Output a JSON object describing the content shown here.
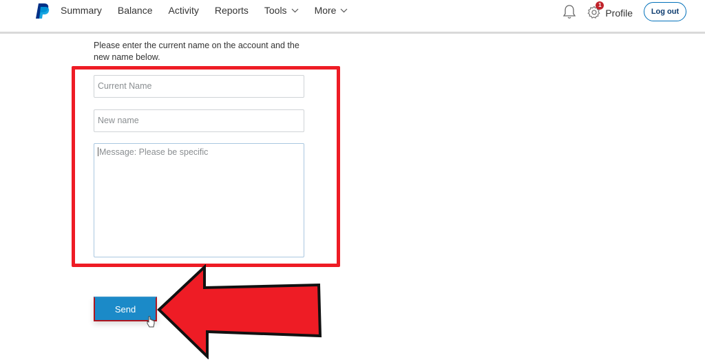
{
  "header": {
    "logo": "paypal-logo",
    "nav": [
      {
        "label": "Summary",
        "has_dropdown": false
      },
      {
        "label": "Balance",
        "has_dropdown": false
      },
      {
        "label": "Activity",
        "has_dropdown": false
      },
      {
        "label": "Reports",
        "has_dropdown": false
      },
      {
        "label": "Tools",
        "has_dropdown": true
      },
      {
        "label": "More",
        "has_dropdown": true
      }
    ],
    "notification_badge": "1",
    "profile_label": "Profile",
    "logout_label": "Log out"
  },
  "form": {
    "instructions": "Please enter the current name on the account and the new name below.",
    "current_name": {
      "value": "",
      "placeholder": "Current Name"
    },
    "new_name": {
      "value": "",
      "placeholder": "New name"
    },
    "message": {
      "value": "",
      "placeholder": "Message: Please be specific"
    },
    "send_label": "Send"
  },
  "annotations": {
    "highlight_color": "#ee1c25",
    "arrow_color": "#ee1c25",
    "arrow_points_to": "send-button"
  },
  "colors": {
    "brand_blue": "#0070ba",
    "button_blue": "#1b8ac8",
    "badge_red": "#c0232b"
  }
}
